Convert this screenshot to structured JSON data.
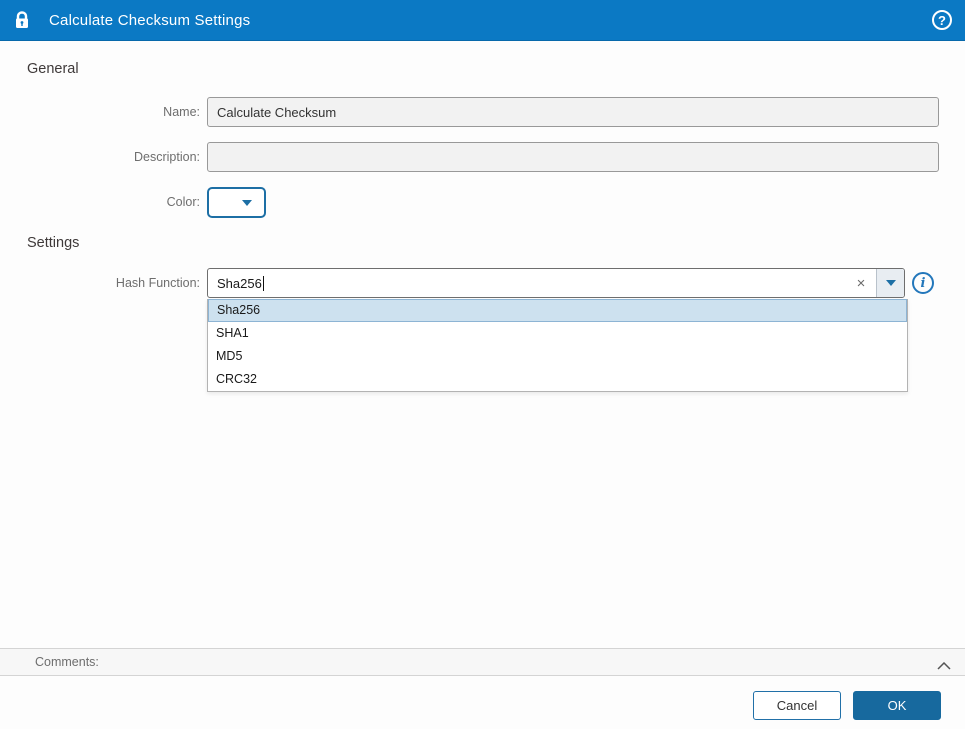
{
  "titlebar": {
    "title": "Calculate Checksum Settings",
    "lock_icon": "lock-icon",
    "help_icon": "help-icon",
    "help_glyph": "?"
  },
  "sections": {
    "general": "General",
    "settings": "Settings"
  },
  "fields": {
    "name": {
      "label": "Name:",
      "value": "Calculate Checksum"
    },
    "description": {
      "label": "Description:",
      "value": ""
    },
    "color": {
      "label": "Color:",
      "value": ""
    },
    "hash": {
      "label": "Hash Function:",
      "value": "Sha256"
    }
  },
  "combobox": {
    "clear_glyph": "×",
    "info_glyph": "i"
  },
  "dropdown": {
    "items": [
      {
        "label": "Sha256",
        "selected": true
      },
      {
        "label": "SHA1",
        "selected": false
      },
      {
        "label": "MD5",
        "selected": false
      },
      {
        "label": "CRC32",
        "selected": false
      }
    ]
  },
  "comments": {
    "label": "Comments:"
  },
  "buttons": {
    "cancel": "Cancel",
    "ok": "OK"
  },
  "colors": {
    "titlebar_bg": "#0b79c4",
    "ok_bg": "#17699e",
    "accent_border": "#1d6fa5",
    "selected_item_bg": "#cde1ef",
    "input_bg": "#f2f2f2",
    "comments_bg": "#f7f7f7"
  }
}
